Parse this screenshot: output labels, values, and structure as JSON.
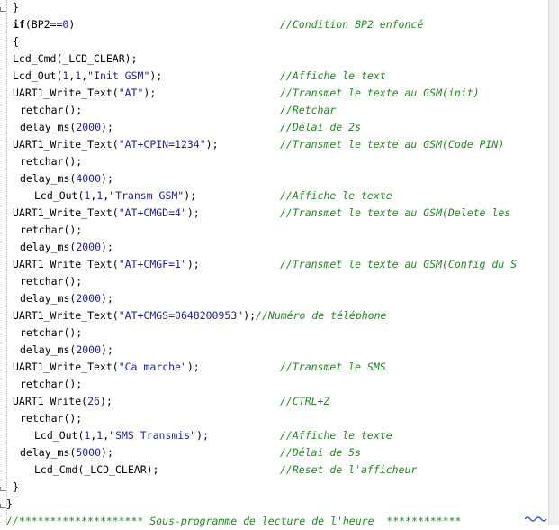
{
  "code_lines": [
    {
      "indent": 0,
      "parts": [
        {
          "t": "}",
          "c": "k"
        }
      ],
      "comment": ""
    },
    {
      "indent": 0,
      "parts": [
        {
          "t": "if",
          "c": "kw"
        },
        {
          "t": "(BP2==",
          "c": "k"
        },
        {
          "t": "0",
          "c": "n"
        },
        {
          "t": ")",
          "c": "k"
        }
      ],
      "comment": "//Condition BP2 enfoncé"
    },
    {
      "indent": 0,
      "parts": [
        {
          "t": "{",
          "c": "k"
        }
      ],
      "comment": ""
    },
    {
      "indent": 0,
      "parts": [
        {
          "t": "Lcd_Cmd(_LCD_CLEAR);",
          "c": "k"
        }
      ],
      "comment": ""
    },
    {
      "indent": 0,
      "parts": [
        {
          "t": "Lcd_Out(",
          "c": "k"
        },
        {
          "t": "1",
          "c": "n"
        },
        {
          "t": ",",
          "c": "k"
        },
        {
          "t": "1",
          "c": "n"
        },
        {
          "t": ",",
          "c": "k"
        },
        {
          "t": "\"Init GSM\"",
          "c": "s"
        },
        {
          "t": ");",
          "c": "k"
        }
      ],
      "comment": "//Affiche le text"
    },
    {
      "indent": 0,
      "parts": [
        {
          "t": "UART1_Write_Text(",
          "c": "k"
        },
        {
          "t": "\"AT\"",
          "c": "s"
        },
        {
          "t": ");",
          "c": "k"
        }
      ],
      "comment": "//Transmet le texte au GSM(init)"
    },
    {
      "indent": 1,
      "parts": [
        {
          "t": "retchar();",
          "c": "k"
        }
      ],
      "comment": "//Retchar"
    },
    {
      "indent": 1,
      "parts": [
        {
          "t": "delay_ms(",
          "c": "k"
        },
        {
          "t": "2000",
          "c": "n"
        },
        {
          "t": ");",
          "c": "k"
        }
      ],
      "comment": "//Délai de 2s"
    },
    {
      "indent": 0,
      "parts": [
        {
          "t": "UART1_Write_Text(",
          "c": "k"
        },
        {
          "t": "\"AT+CPIN=1234\"",
          "c": "s"
        },
        {
          "t": ");",
          "c": "k"
        }
      ],
      "comment": "//Transmet le texte au GSM(Code PIN)"
    },
    {
      "indent": 1,
      "parts": [
        {
          "t": "retchar();",
          "c": "k"
        }
      ],
      "comment": ""
    },
    {
      "indent": 1,
      "parts": [
        {
          "t": "delay_ms(",
          "c": "k"
        },
        {
          "t": "4000",
          "c": "n"
        },
        {
          "t": ");",
          "c": "k"
        }
      ],
      "comment": ""
    },
    {
      "indent": 3,
      "parts": [
        {
          "t": "Lcd_Out(",
          "c": "k"
        },
        {
          "t": "1",
          "c": "n"
        },
        {
          "t": ",",
          "c": "k"
        },
        {
          "t": "1",
          "c": "n"
        },
        {
          "t": ",",
          "c": "k"
        },
        {
          "t": "\"Transm GSM\"",
          "c": "s"
        },
        {
          "t": ");",
          "c": "k"
        }
      ],
      "comment": "//Affiche le texte"
    },
    {
      "indent": 0,
      "parts": [
        {
          "t": "UART1_Write_Text(",
          "c": "k"
        },
        {
          "t": "\"AT+CMGD=4\"",
          "c": "s"
        },
        {
          "t": ");",
          "c": "k"
        }
      ],
      "comment": "//Transmet le texte au GSM(Delete les"
    },
    {
      "indent": 1,
      "parts": [
        {
          "t": "retchar();",
          "c": "k"
        }
      ],
      "comment": ""
    },
    {
      "indent": 1,
      "parts": [
        {
          "t": "delay_ms(",
          "c": "k"
        },
        {
          "t": "2000",
          "c": "n"
        },
        {
          "t": ");",
          "c": "k"
        }
      ],
      "comment": ""
    },
    {
      "indent": 0,
      "parts": [
        {
          "t": "UART1_Write_Text(",
          "c": "k"
        },
        {
          "t": "\"AT+CMGF=1\"",
          "c": "s"
        },
        {
          "t": ");",
          "c": "k"
        }
      ],
      "comment": "//Transmet le texte au GSM(Config du S"
    },
    {
      "indent": 1,
      "parts": [
        {
          "t": "retchar();",
          "c": "k"
        }
      ],
      "comment": ""
    },
    {
      "indent": 1,
      "parts": [
        {
          "t": "delay_ms(",
          "c": "k"
        },
        {
          "t": "2000",
          "c": "n"
        },
        {
          "t": ");",
          "c": "k"
        }
      ],
      "comment": ""
    },
    {
      "indent": 0,
      "parts": [
        {
          "t": "UART1_Write_Text(",
          "c": "k"
        },
        {
          "t": "\"AT+CMGS=0648200953\"",
          "c": "s"
        },
        {
          "t": ");",
          "c": "k"
        },
        {
          "t": "//Numéro de téléphone",
          "c": "cmi"
        }
      ],
      "comment": ""
    },
    {
      "indent": 1,
      "parts": [
        {
          "t": "retchar();",
          "c": "k"
        }
      ],
      "comment": ""
    },
    {
      "indent": 1,
      "parts": [
        {
          "t": "delay_ms(",
          "c": "k"
        },
        {
          "t": "2000",
          "c": "n"
        },
        {
          "t": ");",
          "c": "k"
        }
      ],
      "comment": ""
    },
    {
      "indent": 0,
      "parts": [
        {
          "t": "UART1_Write_Text(",
          "c": "k"
        },
        {
          "t": "\"Ca marche\"",
          "c": "s"
        },
        {
          "t": ");",
          "c": "k"
        }
      ],
      "comment": "//Transmet le SMS"
    },
    {
      "indent": 1,
      "parts": [
        {
          "t": "retchar();",
          "c": "k"
        }
      ],
      "comment": ""
    },
    {
      "indent": 0,
      "parts": [
        {
          "t": "UART1_Write(",
          "c": "k"
        },
        {
          "t": "26",
          "c": "n"
        },
        {
          "t": ");",
          "c": "k"
        }
      ],
      "comment": "//CTRL+Z"
    },
    {
      "indent": 1,
      "parts": [
        {
          "t": "retchar();",
          "c": "k"
        }
      ],
      "comment": ""
    },
    {
      "indent": 3,
      "parts": [
        {
          "t": "Lcd_Out(",
          "c": "k"
        },
        {
          "t": "1",
          "c": "n"
        },
        {
          "t": ",",
          "c": "k"
        },
        {
          "t": "1",
          "c": "n"
        },
        {
          "t": ",",
          "c": "k"
        },
        {
          "t": "\"SMS Transmis\"",
          "c": "s"
        },
        {
          "t": ");",
          "c": "k"
        }
      ],
      "comment": "//Affiche le texte"
    },
    {
      "indent": 1,
      "parts": [
        {
          "t": "delay_ms(",
          "c": "k"
        },
        {
          "t": "5000",
          "c": "n"
        },
        {
          "t": ");",
          "c": "k"
        }
      ],
      "comment": "//Délai de 5s"
    },
    {
      "indent": 3,
      "parts": [
        {
          "t": "Lcd_Cmd(_LCD_CLEAR);",
          "c": "k"
        }
      ],
      "comment": "//Reset de l'afficheur"
    },
    {
      "indent": 0,
      "parts": [
        {
          "t": "}",
          "c": "k"
        }
      ],
      "comment": ""
    },
    {
      "indent": -1,
      "parts": [
        {
          "t": "}",
          "c": "k"
        }
      ],
      "comment": ""
    },
    {
      "indent": -1,
      "parts": [],
      "comment": "",
      "full_comment": "//******************** Sous-programme de lecture de l'heure  ************"
    }
  ],
  "colors": {
    "keyword": "#000000",
    "string": "#1d1da8",
    "number": "#1d1da8",
    "comment": "#208820",
    "gutter_line": "#b8b8b8",
    "background": "#ffffff"
  },
  "icons": {
    "fold_marker": "fold-line-icon",
    "error_squiggle": "spelling-squiggle-icon"
  }
}
